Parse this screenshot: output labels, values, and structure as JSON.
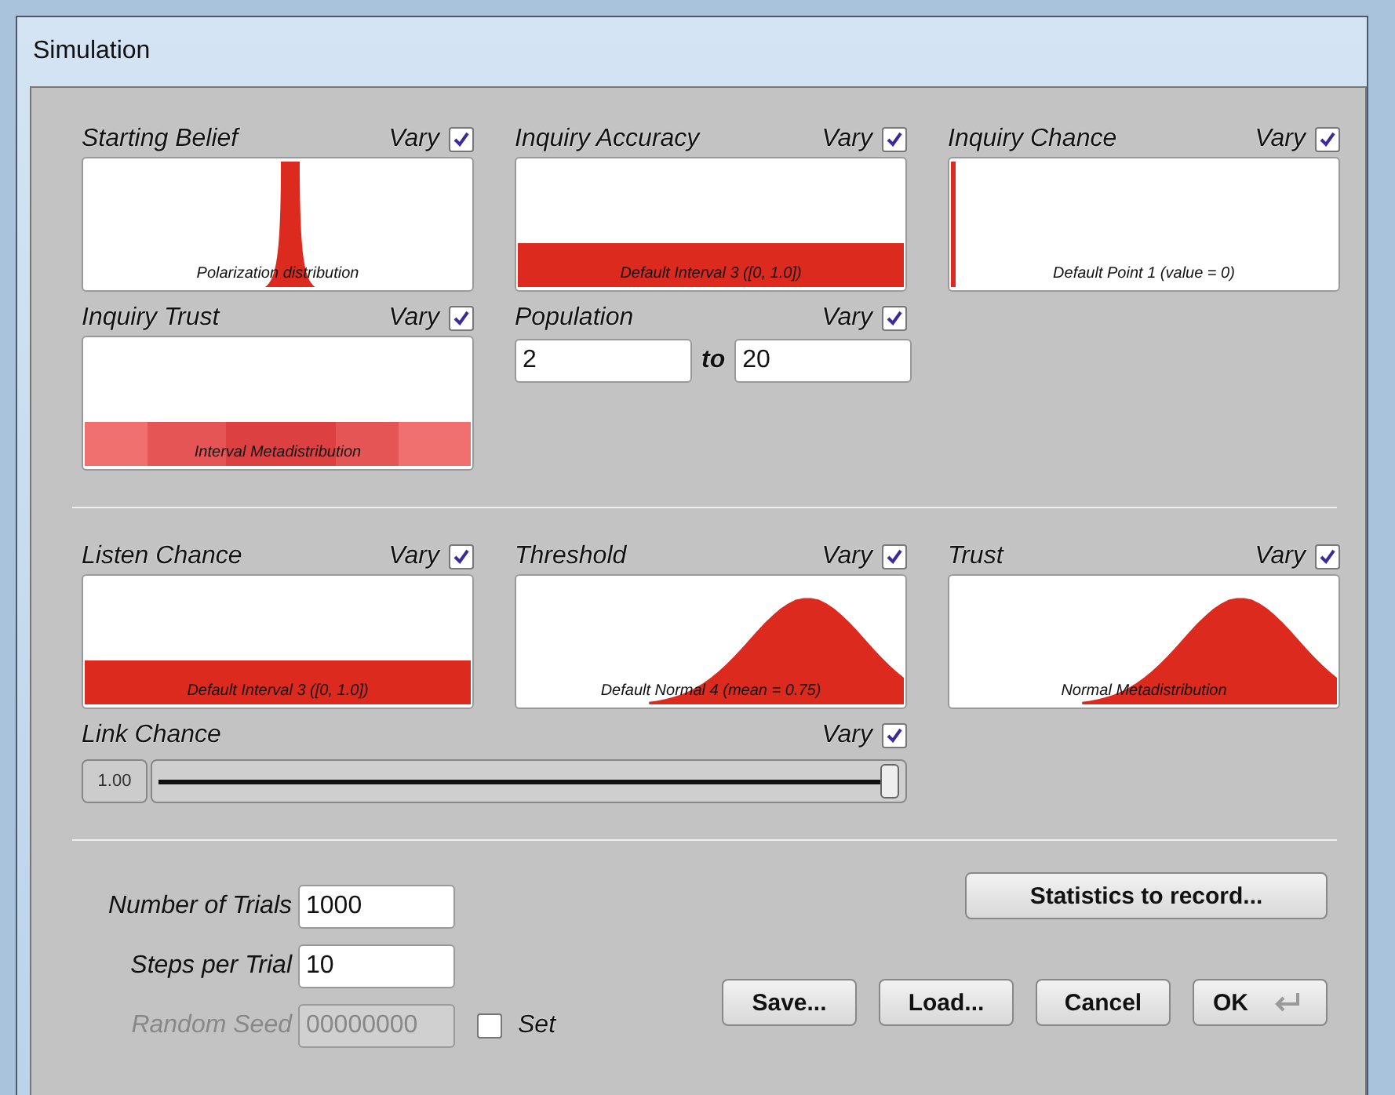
{
  "window": {
    "title": "Simulation"
  },
  "top_parameters": [
    {
      "kind": "distribution",
      "label": "Starting Belief",
      "vary_label": "Vary",
      "vary": true,
      "plot": {
        "kind": "spike",
        "caption": "Polarization distribution"
      }
    },
    {
      "kind": "distribution",
      "label": "Inquiry Accuracy",
      "vary_label": "Vary",
      "vary": true,
      "plot": {
        "kind": "interval",
        "caption": "Default Interval 3 ([0, 1.0])"
      }
    },
    {
      "kind": "distribution",
      "label": "Inquiry Chance",
      "vary_label": "Vary",
      "vary": true,
      "plot": {
        "kind": "point",
        "caption": "Default Point 1 (value = 0)"
      }
    },
    {
      "kind": "distribution",
      "label": "Inquiry Trust",
      "vary_label": "Vary",
      "vary": true,
      "plot": {
        "kind": "interval_meta",
        "caption": "Interval Metadistribution"
      }
    },
    {
      "kind": "range",
      "label": "Population",
      "vary_label": "Vary",
      "vary": true,
      "from": "2",
      "separator": "to",
      "to": "20"
    }
  ],
  "bottom_parameters": [
    {
      "kind": "distribution",
      "label": "Listen Chance",
      "vary_label": "Vary",
      "vary": true,
      "plot": {
        "kind": "interval",
        "caption": "Default Interval 3 ([0, 1.0])"
      }
    },
    {
      "kind": "distribution",
      "label": "Threshold",
      "vary_label": "Vary",
      "vary": true,
      "plot": {
        "kind": "normal",
        "caption": "Default Normal 4 (mean = 0.75)"
      }
    },
    {
      "kind": "distribution",
      "label": "Trust",
      "vary_label": "Vary",
      "vary": true,
      "plot": {
        "kind": "normal",
        "caption": "Normal Metadistribution"
      }
    }
  ],
  "link_chance": {
    "label": "Link Chance",
    "vary_label": "Vary",
    "vary": true,
    "value": "1.00",
    "level": 1.0
  },
  "statistics_button": "Statistics to record...",
  "fields": [
    {
      "label": "Number of Trials",
      "value": "1000",
      "disabled": false
    },
    {
      "label": "Steps per Trial",
      "value": "10",
      "disabled": false
    },
    {
      "label": "Random Seed",
      "value": "00000000",
      "disabled": true
    }
  ],
  "seed_set": {
    "label": "Set",
    "checked": false
  },
  "buttons": [
    {
      "label": "Save...",
      "kind": "plain"
    },
    {
      "label": "Load...",
      "kind": "plain"
    },
    {
      "label": "Cancel",
      "kind": "plain"
    },
    {
      "label": "OK",
      "kind": "default"
    }
  ]
}
